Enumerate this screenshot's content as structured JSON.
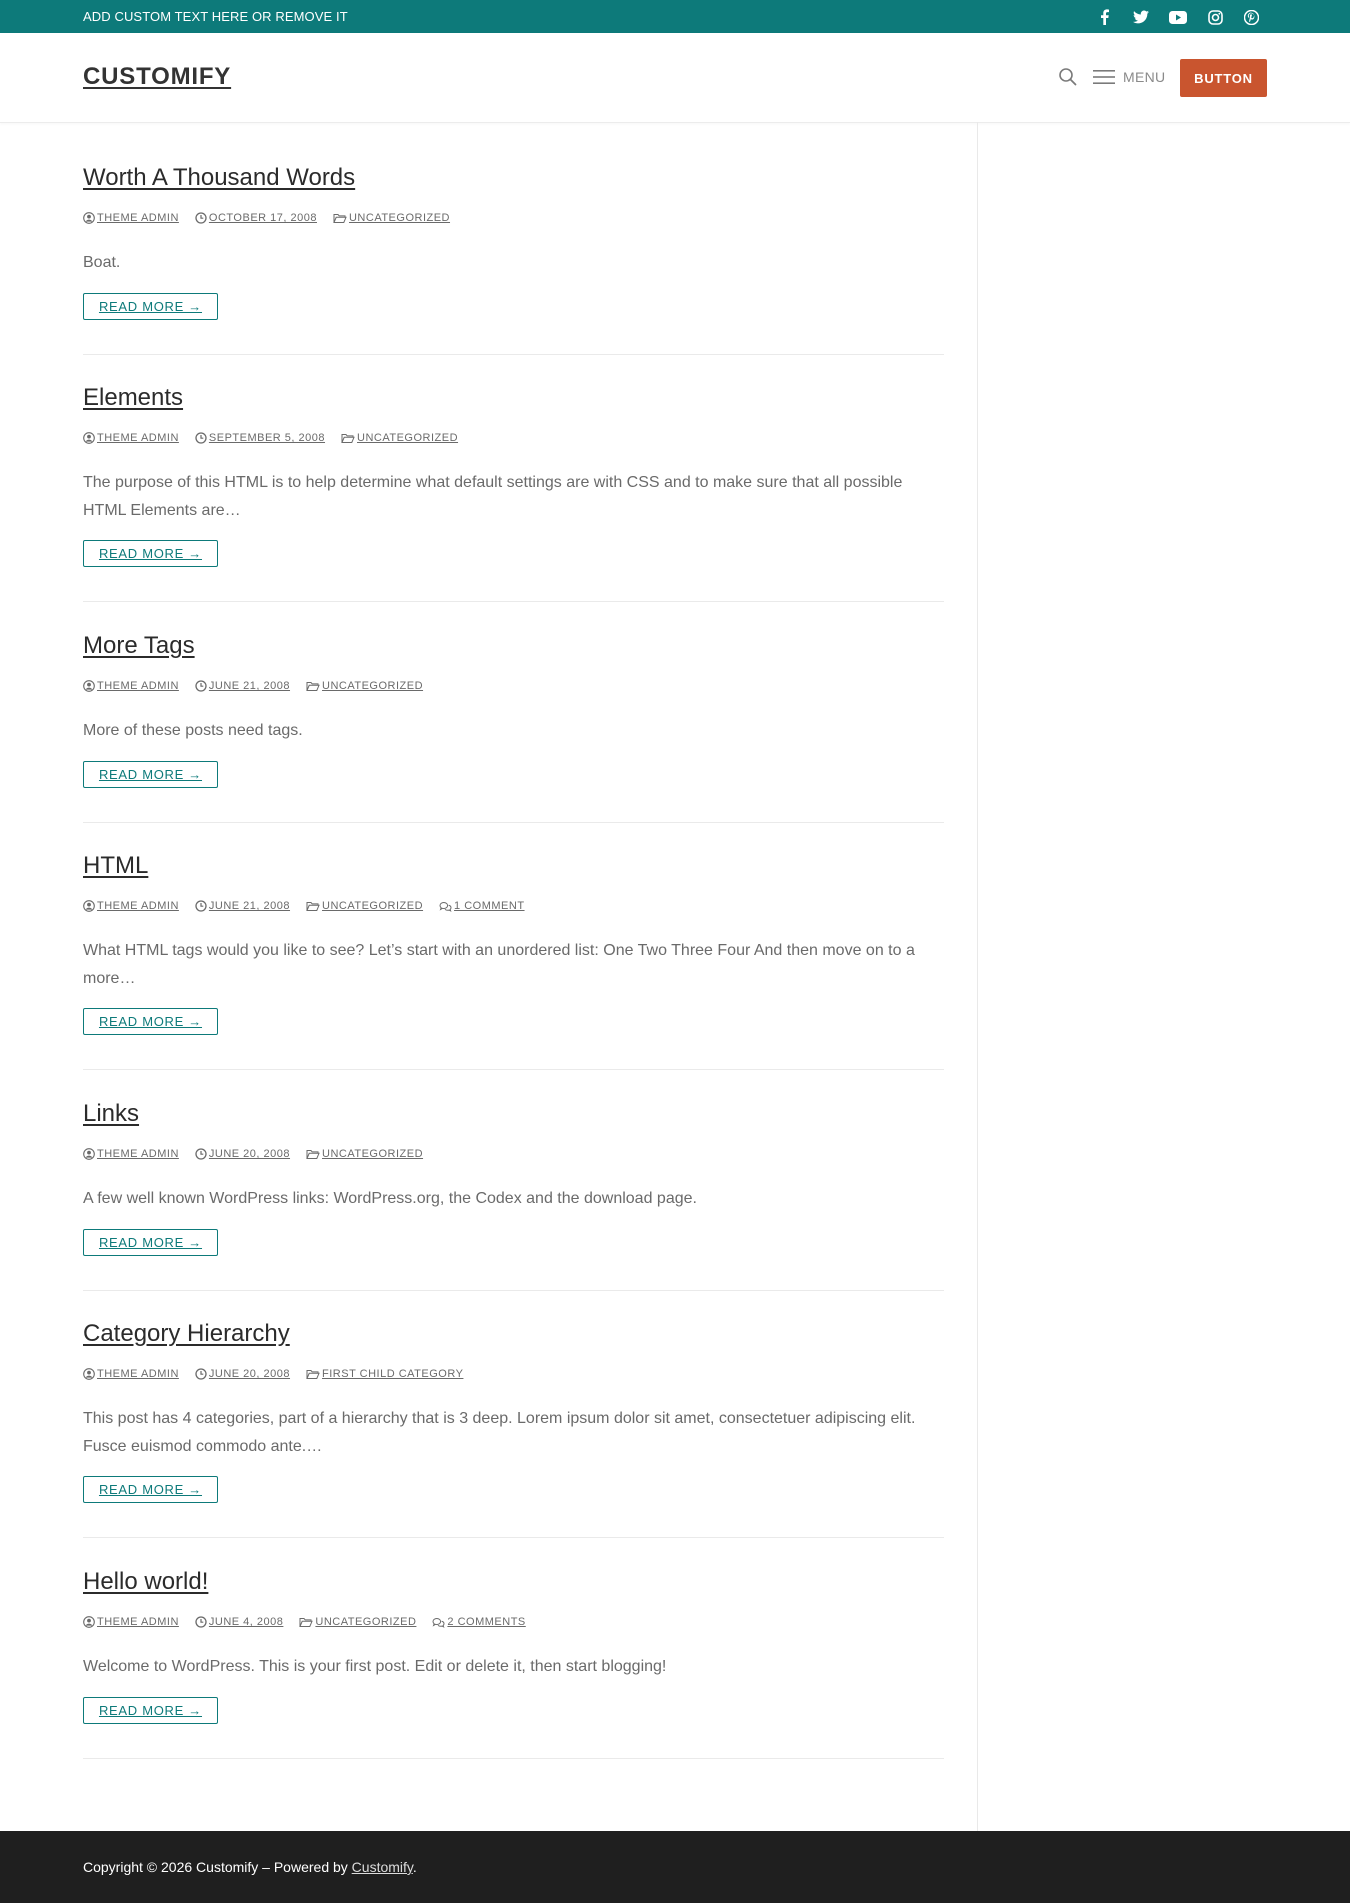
{
  "topbar": {
    "text": "ADD CUSTOM TEXT HERE OR REMOVE IT",
    "social": [
      "facebook-icon",
      "twitter-icon",
      "youtube-icon",
      "instagram-icon",
      "pinterest-icon"
    ],
    "background": "#0d7a7a"
  },
  "header": {
    "logo": "CUSTOMIFY",
    "menu_label": "MENU",
    "button_label": "BUTTON",
    "button_color": "#c9552f"
  },
  "posts": [
    {
      "title": "Worth A Thousand Words",
      "author": "THEME ADMIN",
      "date": "OCTOBER 17, 2008",
      "category": "UNCATEGORIZED",
      "comments": "",
      "excerpt": "Boat.",
      "read_more": "READ MORE →"
    },
    {
      "title": "Elements",
      "author": "THEME ADMIN",
      "date": "SEPTEMBER 5, 2008",
      "category": "UNCATEGORIZED",
      "comments": "",
      "excerpt": "The purpose of this HTML is to help determine what default settings are with CSS and to make sure that all possible HTML Elements are…",
      "read_more": "READ MORE →"
    },
    {
      "title": "More Tags",
      "author": "THEME ADMIN",
      "date": "JUNE 21, 2008",
      "category": "UNCATEGORIZED",
      "comments": "",
      "excerpt": "More of these posts need tags.",
      "read_more": "READ MORE →"
    },
    {
      "title": "HTML",
      "author": "THEME ADMIN",
      "date": "JUNE 21, 2008",
      "category": "UNCATEGORIZED",
      "comments": "1 COMMENT",
      "excerpt": "What HTML tags would you like to see? Let’s start with an unordered list: One Two Three Four And then move on to a more…",
      "read_more": "READ MORE →"
    },
    {
      "title": "Links",
      "author": "THEME ADMIN",
      "date": "JUNE 20, 2008",
      "category": "UNCATEGORIZED",
      "comments": "",
      "excerpt": "A few well known WordPress links: WordPress.org, the Codex and the download page.",
      "read_more": "READ MORE →"
    },
    {
      "title": "Category Hierarchy",
      "author": "THEME ADMIN",
      "date": "JUNE 20, 2008",
      "category": "FIRST CHILD CATEGORY",
      "comments": "",
      "excerpt": "This post has 4 categories, part of a hierarchy that is 3 deep. Lorem ipsum dolor sit amet, consectetuer adipiscing elit. Fusce euismod commodo ante.…",
      "read_more": "READ MORE →"
    },
    {
      "title": "Hello world!",
      "author": "THEME ADMIN",
      "date": "JUNE 4, 2008",
      "category": "UNCATEGORIZED",
      "comments": "2 COMMENTS",
      "excerpt": "Welcome to WordPress. This is your first post. Edit or delete it, then start blogging!",
      "read_more": "READ MORE →"
    }
  ],
  "footer": {
    "prefix": "Copyright © 2026 Customify – Powered by ",
    "link": "Customify",
    "suffix": "."
  }
}
